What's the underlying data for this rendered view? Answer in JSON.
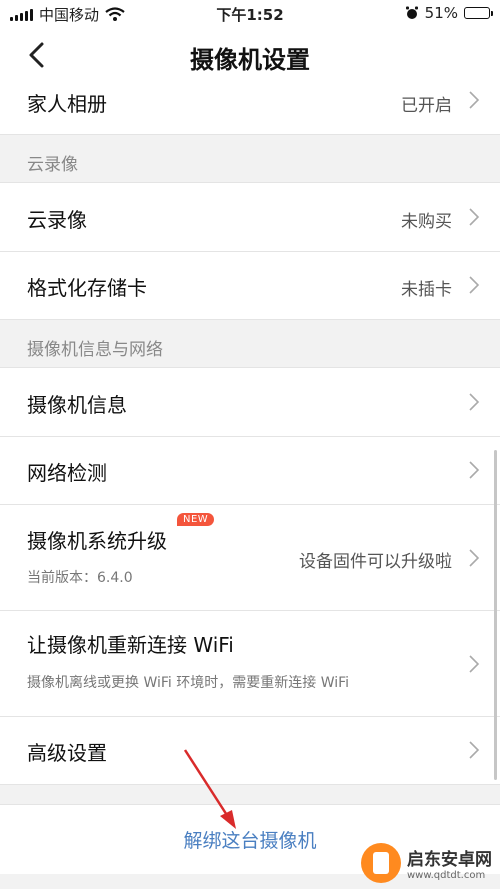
{
  "status_bar": {
    "carrier": "中国移动",
    "time": "下午1:52",
    "battery_percent": "51%",
    "battery_level": 0.51,
    "icons": [
      "signal-icon",
      "wifi-icon",
      "alarm-icon",
      "battery-icon"
    ]
  },
  "nav": {
    "title": "摄像机设置",
    "back_icon": "chevron-left-icon"
  },
  "rows": {
    "family_album": {
      "label": "家人相册",
      "value": "已开启"
    },
    "cloud_section": "云录像",
    "cloud_recording": {
      "label": "云录像",
      "value": "未购买"
    },
    "format_sd": {
      "label": "格式化存储卡",
      "value": "未插卡"
    },
    "info_section": "摄像机信息与网络",
    "camera_info": {
      "label": "摄像机信息"
    },
    "network_check": {
      "label": "网络检测"
    },
    "system_upgrade": {
      "label": "摄像机系统升级",
      "badge": "NEW",
      "sub": "当前版本：6.4.0",
      "value": "设备固件可以升级啦"
    },
    "reconnect_wifi": {
      "label": "让摄像机重新连接 WiFi",
      "sub": "摄像机离线或更换 WiFi 环境时，需要重新连接 WiFi"
    },
    "advanced": {
      "label": "高级设置"
    }
  },
  "unbind": {
    "label": "解绑这台摄像机"
  },
  "watermark": {
    "title": "启东安卓网",
    "url": "www.qdtdt.com"
  },
  "colors": {
    "accent_link": "#4a7fc1",
    "badge": "#f4553c",
    "annotation_arrow": "#d92b2b"
  }
}
